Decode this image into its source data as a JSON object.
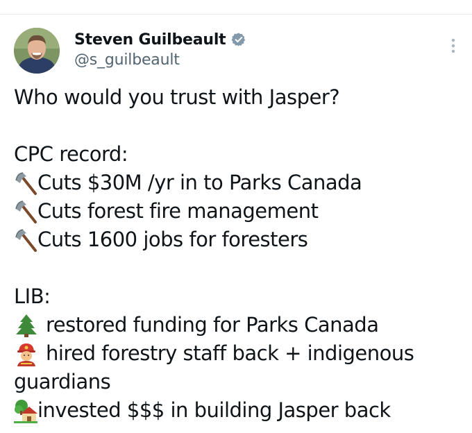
{
  "author": {
    "display_name": "Steven Guilbeault",
    "handle": "@s_guilbeault"
  },
  "icons": {
    "avatar": "avatar",
    "verified": "verified-badge-icon",
    "more": "more-vertical-icon",
    "axe": "axe-icon",
    "tree": "evergreen-tree-icon",
    "firefighter": "firefighter-icon",
    "house": "house-with-garden-icon"
  },
  "tweet": {
    "line1": "Who would you trust with Jasper?",
    "cpc_heading": "CPC record:",
    "cpc_items": [
      "Cuts $30M /yr in to Parks Canada",
      "Cuts forest fire management",
      "Cuts 1600 jobs for foresters"
    ],
    "lib_heading": "LIB:",
    "lib_item1": "restored funding for Parks Canada",
    "lib_item2_a": "hired forestry staff back + indigenous",
    "lib_item2_b": "guardians",
    "lib_item3": "invested $$$ in building Jasper back"
  },
  "colors": {
    "text": "#0f1419",
    "secondary": "#536471",
    "verified": "#829aab"
  }
}
